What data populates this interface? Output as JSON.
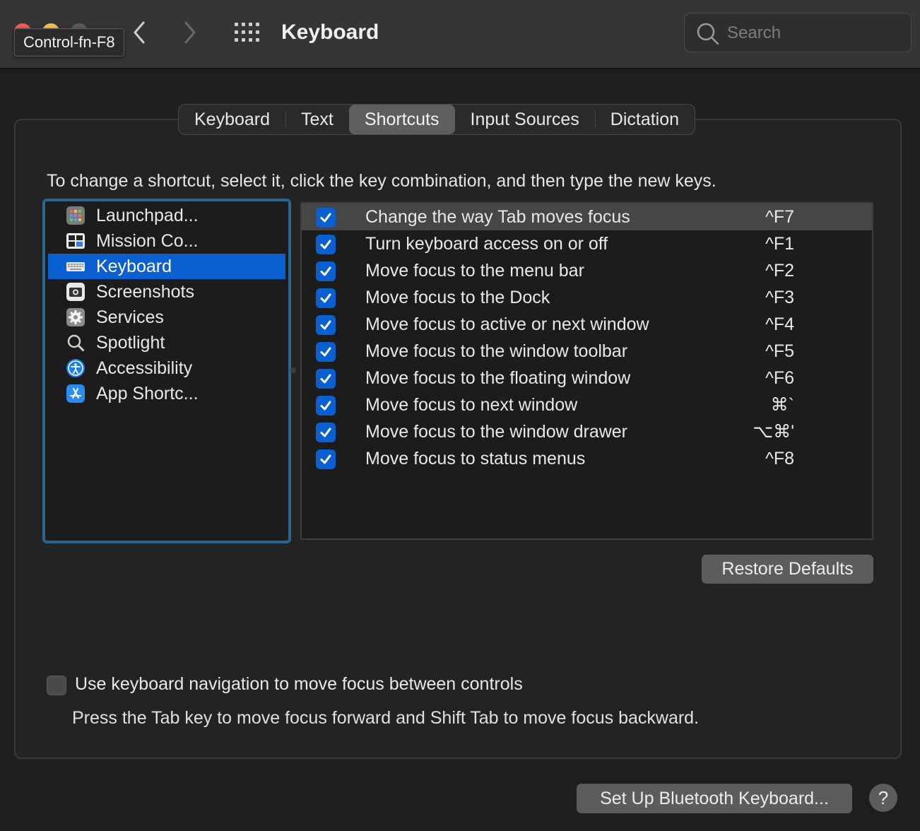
{
  "window": {
    "title": "Keyboard",
    "tooltip": "Control-fn-F8",
    "search_placeholder": "Search"
  },
  "tabs": [
    {
      "label": "Keyboard"
    },
    {
      "label": "Text"
    },
    {
      "label": "Shortcuts",
      "active": true
    },
    {
      "label": "Input Sources"
    },
    {
      "label": "Dictation"
    }
  ],
  "instructions": "To change a shortcut, select it, click the key combination, and then type the new keys.",
  "categories": [
    {
      "label": "Launchpad...",
      "icon": "launchpad-icon"
    },
    {
      "label": "Mission Co...",
      "icon": "mission-control-icon"
    },
    {
      "label": "Keyboard",
      "icon": "keyboard-icon",
      "selected": true
    },
    {
      "label": "Screenshots",
      "icon": "screenshot-icon"
    },
    {
      "label": "Services",
      "icon": "gear-icon"
    },
    {
      "label": "Spotlight",
      "icon": "magnifier-icon"
    },
    {
      "label": "Accessibility",
      "icon": "accessibility-icon"
    },
    {
      "label": "App Shortc...",
      "icon": "app-store-icon"
    }
  ],
  "shortcuts": [
    {
      "label": "Change the way Tab moves focus",
      "key": "^F7",
      "checked": true,
      "highlighted": true
    },
    {
      "label": "Turn keyboard access on or off",
      "key": "^F1",
      "checked": true
    },
    {
      "label": "Move focus to the menu bar",
      "key": "^F2",
      "checked": true
    },
    {
      "label": "Move focus to the Dock",
      "key": "^F3",
      "checked": true
    },
    {
      "label": "Move focus to active or next window",
      "key": "^F4",
      "checked": true
    },
    {
      "label": "Move focus to the window toolbar",
      "key": "^F5",
      "checked": true
    },
    {
      "label": "Move focus to the floating window",
      "key": "^F6",
      "checked": true
    },
    {
      "label": "Move focus to next window",
      "key": "⌘`",
      "checked": true
    },
    {
      "label": "Move focus to the window drawer",
      "key": "⌥⌘'",
      "checked": true
    },
    {
      "label": "Move focus to status menus",
      "key": "^F8",
      "checked": true
    }
  ],
  "restore_defaults_label": "Restore Defaults",
  "keyboard_navigation": {
    "label": "Use keyboard navigation to move focus between controls",
    "checked": false,
    "description": "Press the Tab key to move focus forward and Shift Tab to move focus backward."
  },
  "bluetooth_button_label": "Set Up Bluetooth Keyboard...",
  "help_label": "?",
  "colors": {
    "accent": "#0a60d0",
    "focus_ring": "#27658f",
    "window_bg": "#1e1e1e",
    "titlebar_bg": "#353535"
  }
}
